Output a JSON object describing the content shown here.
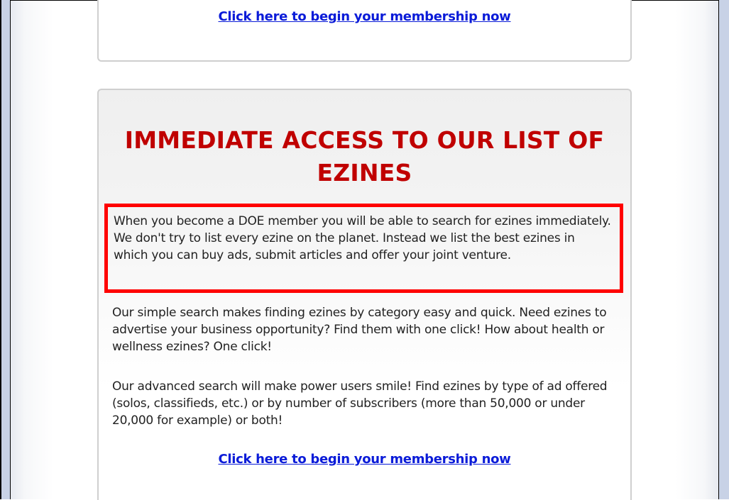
{
  "top_box": {
    "cta_label": "Click here to begin your membership now"
  },
  "section": {
    "heading": "IMMEDIATE ACCESS TO OUR LIST OF EZINES",
    "highlight_paragraph": "When you become a DOE member you will be able to search for ezines immediately. We don't try to list every ezine on the planet. Instead we list the best ezines in which you can buy ads, submit articles and offer your joint venture.",
    "paragraph_2": "Our simple search makes finding ezines by category easy and quick. Need ezines to advertise your business opportunity? Find them with one click! How about health or wellness ezines? One click!",
    "paragraph_3": "Our advanced search will make power users smile! Find ezines by type of ad offered (solos, classifieds, etc.) or by number of subscribers (more than 50,000 or under 20,000 for example) or both!",
    "cta_label": "Click here to begin your membership now"
  },
  "colors": {
    "heading": "#c00000",
    "link": "#0a1bd8",
    "highlight_border": "#ff0000"
  }
}
